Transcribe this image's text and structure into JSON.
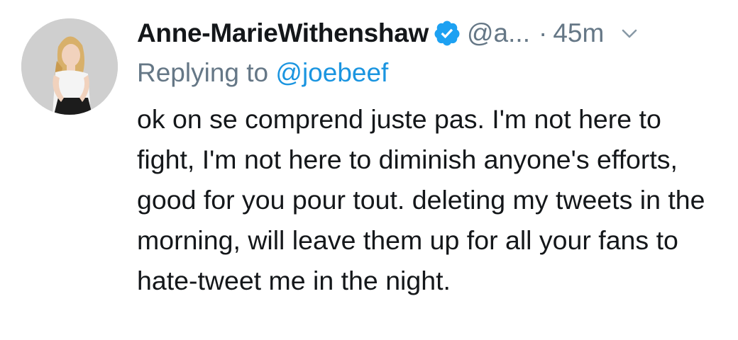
{
  "tweet": {
    "author": {
      "display_name": "Anne-MarieWithenshaw",
      "handle": "@a...",
      "verified_icon": "verified-badge-icon",
      "avatar_icon": "profile-photo-avatar"
    },
    "separator": "·",
    "timestamp": "45m",
    "menu_icon": "chevron-down-icon",
    "replying_to_label": "Replying to",
    "replying_to_handle": "@joebeef",
    "text": "ok on se comprend juste pas. I'm not here to fight, I'm not here to diminish anyone's efforts, good for you pour tout. deleting my tweets in the morning, will leave them up for all your fans to hate-tweet me in the night.",
    "colors": {
      "verified": "#1da1f2",
      "link": "#1b95e0",
      "secondary_text": "#657786",
      "primary_text": "#14171a"
    }
  }
}
